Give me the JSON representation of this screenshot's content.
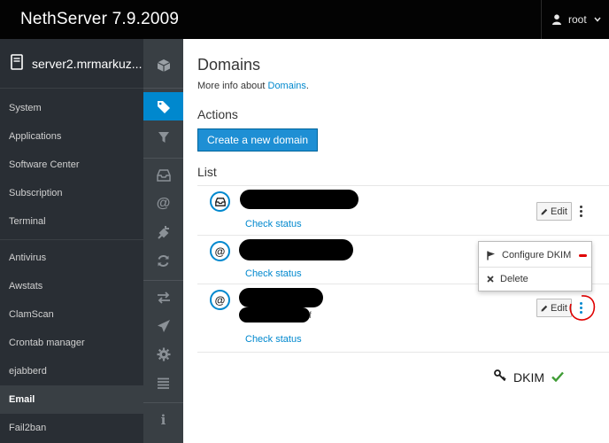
{
  "topbar": {
    "brand": "NethServer 7.9.2009",
    "user": "root"
  },
  "sidebar": {
    "server_name": "server2.mrmarkuz....",
    "items": [
      {
        "label": "System"
      },
      {
        "label": "Applications"
      },
      {
        "label": "Software Center"
      },
      {
        "label": "Subscription"
      },
      {
        "label": "Terminal"
      },
      {
        "label": "Antivirus"
      },
      {
        "label": "Awstats"
      },
      {
        "label": "ClamScan"
      },
      {
        "label": "Crontab manager"
      },
      {
        "label": "ejabberd"
      },
      {
        "label": "Email"
      },
      {
        "label": "Fail2ban"
      }
    ]
  },
  "rail": {
    "icons": [
      "cube-icon",
      "tag-icon",
      "filter-icon",
      "inbox-icon",
      "at-icon",
      "plug-icon",
      "refresh-icon",
      "exchange-icon",
      "paper-plane-icon",
      "cog-icon",
      "list-icon",
      "info-icon"
    ]
  },
  "main": {
    "title": "Domains",
    "info_prefix": "More info about",
    "info_link": "Domains",
    "info_suffix": ".",
    "actions_heading": "Actions",
    "create_button": "Create a new domain",
    "list_heading": "List",
    "rows": [
      {
        "icon": "inbox-icon",
        "check_label": "Check status",
        "edit_label": "Edit"
      },
      {
        "icon": "at-icon",
        "icon_text": "@",
        "check_label": "Check status"
      },
      {
        "icon": "at-icon",
        "icon_text": "@",
        "check_label": "Check status",
        "edit_label": "Edit",
        "fragment": "f",
        "dkim_label": "DKIM"
      }
    ],
    "dropdown": [
      {
        "label": "Configure DKIM"
      },
      {
        "label": "Delete"
      }
    ]
  },
  "colors": {
    "accent": "#0088ce",
    "sidebar": "#292e34",
    "rail": "#393f44",
    "topbar": "#030303",
    "ok": "#3f9c35",
    "annotation": "#e00000"
  }
}
